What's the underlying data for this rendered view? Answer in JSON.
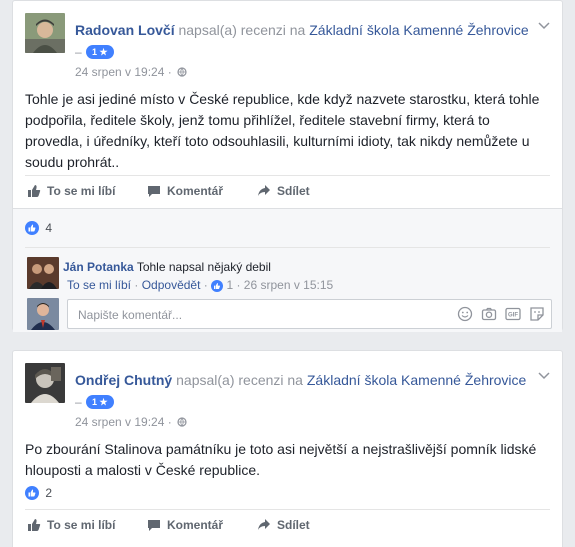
{
  "posts": [
    {
      "author": "Radovan Lovčí",
      "verb": "napsal(a) recenzi na",
      "page": "Základní škola Kamenné Žehrovice",
      "dash": "–",
      "rating": "1 ★",
      "date": "24 srpen v 19:24 ·",
      "text": "Tohle je asi jediné místo v České republice, kde když nazvete starostku, která tohle podpořila, ředitele školy, jenž tomu přihlížel, ředitele stavební firmy, která to provedla, i úředníky, kteří toto odsouhlasili, kulturními idioty, tak nikdy nemůžete u soudu prohrát..",
      "actions": {
        "like": "To se mi líbí",
        "comment": "Komentář",
        "share": "Sdílet"
      },
      "likes": "4",
      "comment": {
        "name": "Ján Potanka",
        "text": "Tohle napsal nějaký debil",
        "like": "To se mi líbí",
        "reply": "Odpovědět",
        "sep": "·",
        "meta": "1 · 26 srpen v 15:15"
      },
      "write_placeholder": "Napište komentář..."
    },
    {
      "author": "Ondřej Chutný",
      "verb": "napsal(a) recenzi na",
      "page": "Základní škola Kamenné Žehrovice",
      "dash": "–",
      "rating": "1 ★",
      "date": "24 srpen v 19:24 ·",
      "text": "Po zbourání Stalinova památníku je toto asi největší a nejstrašlivější pomník lidské hlouposti a malosti v České republice.",
      "actions": {
        "like": "To se mi líbí",
        "comment": "Komentář",
        "share": "Sdílet"
      },
      "likes": "2"
    }
  ],
  "colors": {
    "link": "#365899",
    "meta": "#90949c",
    "accent": "#4080ff",
    "background": "#e9ebee"
  },
  "icons": [
    "thumbs-up-icon",
    "comment-icon",
    "share-icon",
    "globe-icon",
    "chevron-down-icon",
    "emoji-icon",
    "camera-icon",
    "gif-icon",
    "sticker-icon"
  ]
}
